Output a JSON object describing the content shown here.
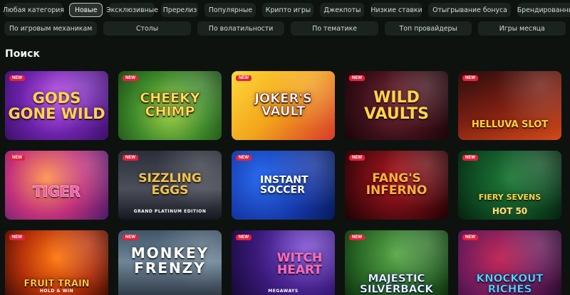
{
  "filters_row1": [
    {
      "label": "Любая категория",
      "active": false
    },
    {
      "label": "Новые",
      "active": true
    },
    {
      "label": "Эксклюзивные",
      "active": false
    },
    {
      "label": "Пререлиз",
      "active": false
    },
    {
      "label": "Популярные",
      "active": false
    },
    {
      "label": "Крипто игры",
      "active": false
    },
    {
      "label": "Джекпоты",
      "active": false
    },
    {
      "label": "Низкие ставки",
      "active": false
    },
    {
      "label": "Отыгрывание бонуса",
      "active": false
    },
    {
      "label": "Брендированные игры",
      "active": false
    }
  ],
  "filters_row2": [
    {
      "label": "По игровым механикам"
    },
    {
      "label": "Столы"
    },
    {
      "label": "По волатильности"
    },
    {
      "label": "По тематике"
    },
    {
      "label": "Топ провайдеры"
    },
    {
      "label": "Игры месяца"
    }
  ],
  "section_title": "Поиск",
  "badge_label": "NEW",
  "games": [
    {
      "title": "GODS GONE WILD",
      "subtitle": "",
      "theme": "gods",
      "icon": "gods-art"
    },
    {
      "title": "CHEEKY CHIMP",
      "subtitle": "",
      "theme": "cheeky",
      "icon": "chimp-art"
    },
    {
      "title": "JOKER'S VAULT",
      "subtitle": "",
      "theme": "joker",
      "icon": "joker-art"
    },
    {
      "title": "WILD VAULTS",
      "subtitle": "",
      "theme": "wild",
      "icon": "vault-art"
    },
    {
      "title": "HELLUVA SLOT",
      "subtitle": "",
      "theme": "helluva",
      "icon": "demon-art"
    },
    {
      "title": "TIGER",
      "subtitle": "",
      "theme": "tiger",
      "icon": "tiger-art"
    },
    {
      "title": "SIZZLING EGGS",
      "subtitle": "GRAND PLATINUM EDITION",
      "theme": "sizzling",
      "icon": "eggs-art"
    },
    {
      "title": "INSTANT SOCCER",
      "subtitle": "",
      "theme": "soccer",
      "icon": "soccer-art"
    },
    {
      "title": "FANG'S INFERNO",
      "subtitle": "",
      "theme": "fang",
      "icon": "inferno-art"
    },
    {
      "title": "FIERY SEVENS",
      "subtitle": "HOT 50",
      "theme": "fiery",
      "icon": "sevens-art"
    },
    {
      "title": "FRUIT TRAIN",
      "subtitle": "HOLD & WIN",
      "theme": "fruit",
      "icon": "train-art"
    },
    {
      "title": "MONKEY FRENZY",
      "subtitle": "",
      "theme": "monkey",
      "icon": "monkey-art"
    },
    {
      "title": "WITCH HEART",
      "subtitle": "MEGAWAYS",
      "theme": "witch",
      "icon": "witch-art"
    },
    {
      "title": "MAJESTIC SILVERBACK",
      "subtitle": "",
      "theme": "majestic",
      "icon": "gorilla-art"
    },
    {
      "title": "KNOCKOUT RICHES",
      "subtitle": "",
      "theme": "knockout",
      "icon": "boxer-art"
    }
  ]
}
